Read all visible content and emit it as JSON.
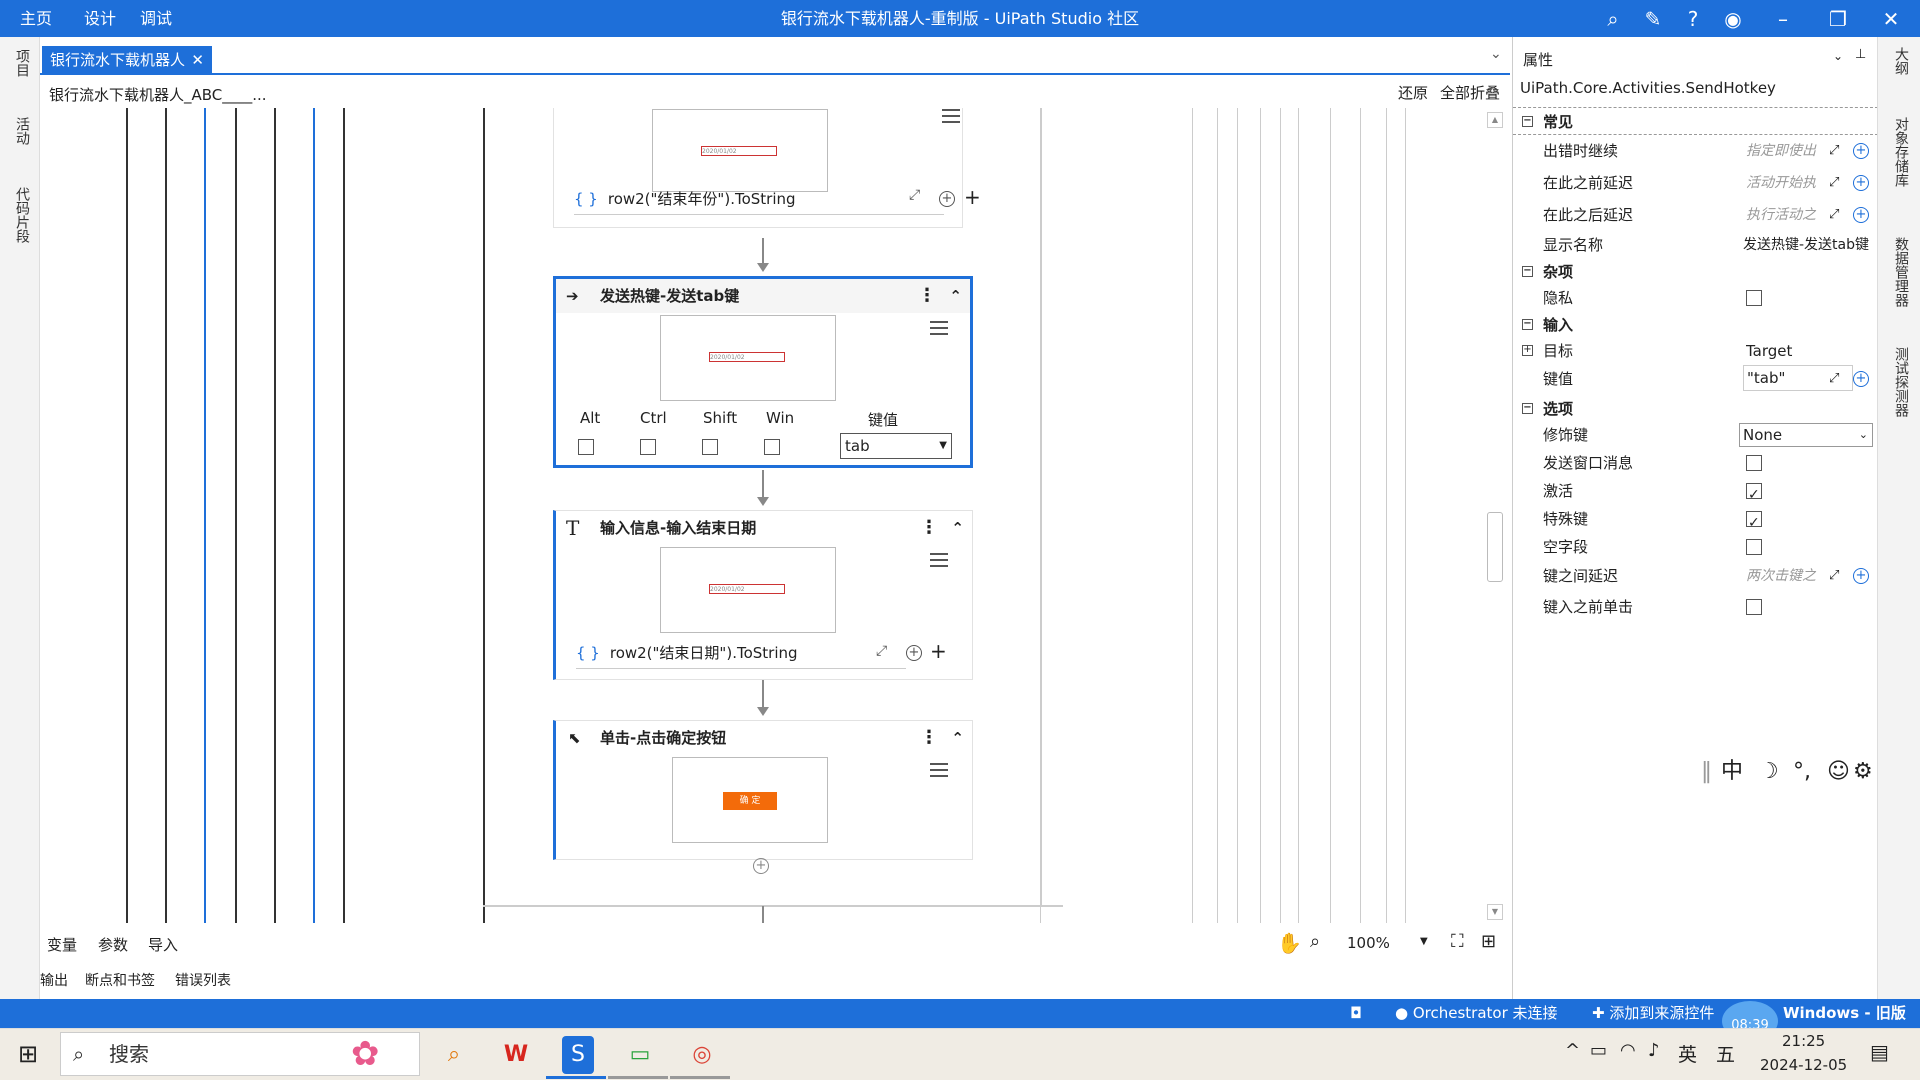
{
  "titlebar": {
    "menu": [
      "主页",
      "设计",
      "调试"
    ],
    "title": "银行流水下载机器人-重制版 - UiPath Studio 社区"
  },
  "leftrail": {
    "items": [
      "项目",
      "活动",
      "代码片段"
    ]
  },
  "tab": {
    "label": "银行流水下载机器人"
  },
  "breadcrumb": {
    "path": "银行流水下载机器人_ABC____...",
    "restore": "还原",
    "collapse_all": "全部折叠"
  },
  "activities": {
    "top_expr": "row2(\"结束年份\").ToString",
    "hotkey": {
      "title": "发送热键-发送tab键",
      "mods": [
        "Alt",
        "Ctrl",
        "Shift",
        "Win"
      ],
      "key_label": "键值",
      "key_value": "tab"
    },
    "type_into": {
      "title": "输入信息-输入结束日期",
      "expr": "row2(\"结束日期\").ToString"
    },
    "click": {
      "title": "单击-点击确定按钮",
      "button_text": "确 定"
    },
    "thumb_date": "2020/01/02"
  },
  "designer_bottom": {
    "tabs1": [
      "变量",
      "参数",
      "导入"
    ],
    "tabs2": [
      "输出",
      "断点和书签",
      "错误列表"
    ],
    "zoom": "100%"
  },
  "properties": {
    "panel_title": "属性",
    "activity_type": "UiPath.Core.Activities.SendHotkey",
    "sections": {
      "common": "常见",
      "misc": "杂项",
      "input": "输入",
      "options": "选项"
    },
    "rows": {
      "continue_on_error": {
        "label": "出错时继续",
        "placeholder": "指定即使出"
      },
      "delay_before": {
        "label": "在此之前延迟",
        "placeholder": "活动开始执"
      },
      "delay_after": {
        "label": "在此之后延迟",
        "placeholder": "执行活动之"
      },
      "display_name": {
        "label": "显示名称",
        "value": "发送热键-发送tab键"
      },
      "private": {
        "label": "隐私"
      },
      "target": {
        "label": "目标",
        "value": "Target"
      },
      "key": {
        "label": "键值",
        "value": "\"tab\""
      },
      "modifiers": {
        "label": "修饰键",
        "value": "None"
      },
      "send_window_msg": {
        "label": "发送窗口消息"
      },
      "activate": {
        "label": "激活"
      },
      "special_key": {
        "label": "特殊键"
      },
      "empty_field": {
        "label": "空字段"
      },
      "delay_between_keys": {
        "label": "键之间延迟",
        "placeholder": "两次击键之"
      },
      "click_before": {
        "label": "键入之前单击"
      }
    }
  },
  "rightrail": {
    "items": [
      "大纲",
      "对象存储库",
      "数据管理器",
      "测试探测器"
    ]
  },
  "ime": {
    "lang": "中"
  },
  "statusbar": {
    "orchestrator": "Orchestrator 未连接",
    "add_source": "添加到来源控件",
    "windows": "Windows - 旧版",
    "time_badge": "08:39"
  },
  "taskbar": {
    "search": "搜索",
    "lang": "英",
    "ime": "五",
    "time": "21:25",
    "date": "2024-12-05"
  },
  "colors": {
    "accent": "#1e6fd9",
    "orange": "#f36b0a"
  }
}
